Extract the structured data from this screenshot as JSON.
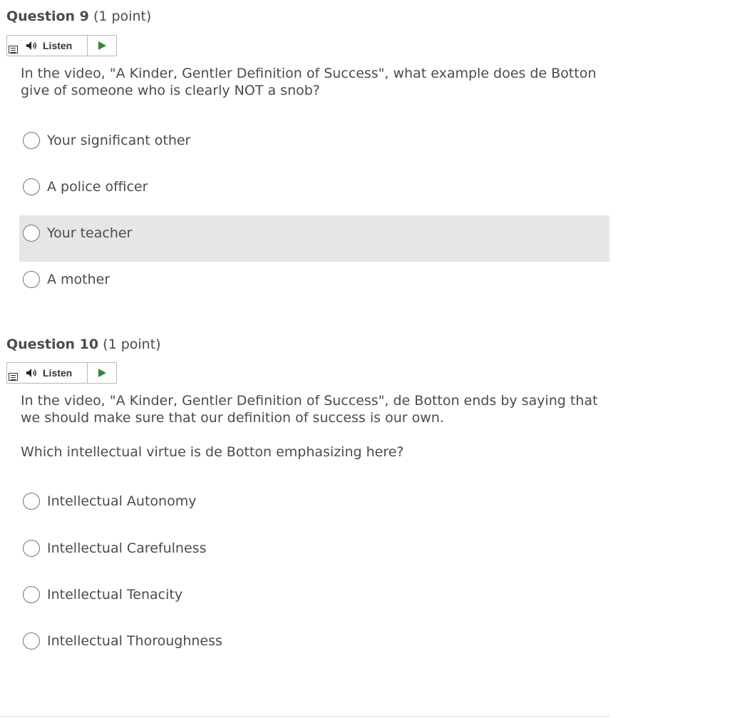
{
  "questions": [
    {
      "number_label": "Question 9",
      "points_label": "(1 point)",
      "listen_label": "Listen",
      "paragraphs": [
        "In the video, \"A Kinder, Gentler Definition of Success\", what example does de Botton give of someone who is clearly NOT a snob?"
      ],
      "options": [
        {
          "label": "Your significant other",
          "selected": false
        },
        {
          "label": "A police officer",
          "selected": false
        },
        {
          "label": "Your teacher",
          "selected": false,
          "hovered": true
        },
        {
          "label": "A mother",
          "selected": false
        }
      ]
    },
    {
      "number_label": "Question 10",
      "points_label": "(1 point)",
      "listen_label": "Listen",
      "paragraphs": [
        "In the video, \"A Kinder, Gentler Definition of Success\", de Botton ends by saying that we should make sure that our definition of success is our own.",
        "Which intellectual virtue is de Botton emphasizing here?"
      ],
      "options": [
        {
          "label": "Intellectual Autonomy",
          "selected": false
        },
        {
          "label": "Intellectual Carefulness",
          "selected": false
        },
        {
          "label": "Intellectual Tenacity",
          "selected": false
        },
        {
          "label": "Intellectual Thoroughness",
          "selected": false
        }
      ]
    }
  ],
  "icons": {
    "menu": "menu-icon",
    "speaker": "speaker-icon",
    "play": "play-icon"
  },
  "colors": {
    "text": "#494c4e",
    "play_green": "#2e8b2e",
    "hover_bg": "#e6e6e6",
    "border": "#b5b8bb"
  }
}
